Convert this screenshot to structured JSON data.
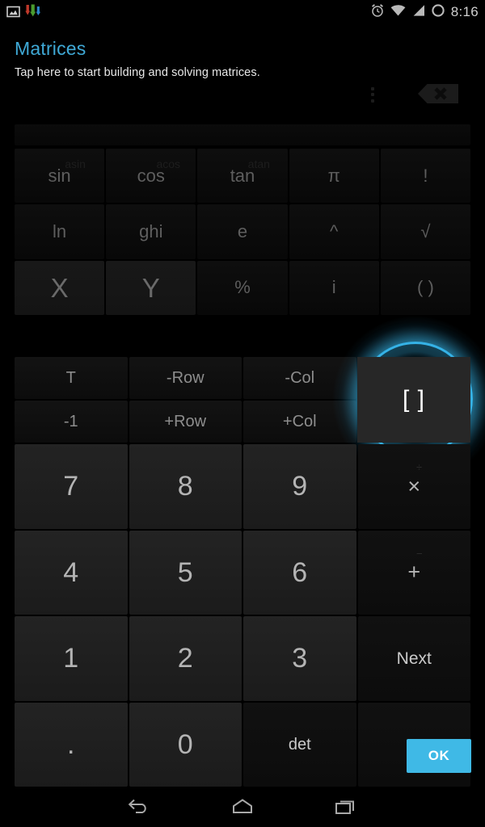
{
  "status_bar": {
    "left_icons": [
      {
        "name": "screenshot-icon",
        "label": "screenshot"
      },
      {
        "name": "downloads-icon",
        "label": "downloads"
      }
    ],
    "right_icons": [
      {
        "name": "alarm-icon",
        "label": "alarm"
      },
      {
        "name": "wifi-icon",
        "label": "wifi"
      },
      {
        "name": "signal-icon",
        "label": "cellular signal"
      },
      {
        "name": "battery-icon",
        "label": "battery"
      }
    ],
    "clock": "8:16"
  },
  "header": {
    "title": "Matrices",
    "title_color": "#3fa9d6",
    "subtitle": "Tap here to start building and solving matrices.",
    "overflow_label": "More options",
    "backspace_label": "Delete"
  },
  "display": {
    "value": ""
  },
  "function_keys": [
    {
      "main": "sin",
      "alt": "asin",
      "bright": false
    },
    {
      "main": "cos",
      "alt": "acos",
      "bright": false
    },
    {
      "main": "tan",
      "alt": "atan",
      "bright": false
    },
    {
      "main": "π",
      "alt": "",
      "bright": false
    },
    {
      "main": "!",
      "alt": "",
      "bright": false
    },
    {
      "main": "ln",
      "alt": "",
      "bright": false
    },
    {
      "main": "ghi",
      "alt": "",
      "bright": false
    },
    {
      "main": "e",
      "alt": "",
      "bright": false
    },
    {
      "main": "^",
      "alt": "",
      "bright": false
    },
    {
      "main": "√",
      "alt": "",
      "bright": false
    },
    {
      "main": "X",
      "alt": "",
      "bright": true
    },
    {
      "main": "Y",
      "alt": "",
      "bright": true
    },
    {
      "main": "%",
      "alt": "",
      "bright": false
    },
    {
      "main": "i",
      "alt": "",
      "bright": false
    },
    {
      "main": "( )",
      "alt": "",
      "bright": false
    }
  ],
  "matrix_op_keys": [
    {
      "main": "T"
    },
    {
      "main": "-Row"
    },
    {
      "main": "-Col"
    },
    {
      "main": "-1"
    },
    {
      "main": "+Row"
    },
    {
      "main": "+Col"
    }
  ],
  "focused_key": {
    "label": "[ ]",
    "name": "matrix-bracket-key",
    "ring_color": "#35b2e6"
  },
  "numeric_keys": [
    {
      "main": "7",
      "alt": "",
      "style": "digit"
    },
    {
      "main": "8",
      "alt": "",
      "style": "digit"
    },
    {
      "main": "9",
      "alt": "",
      "style": "digit"
    },
    {
      "main": "×",
      "alt": "÷",
      "style": "op"
    },
    {
      "main": "4",
      "alt": "",
      "style": "digit"
    },
    {
      "main": "5",
      "alt": "",
      "style": "digit"
    },
    {
      "main": "6",
      "alt": "",
      "style": "digit"
    },
    {
      "main": "+",
      "alt": "−",
      "style": "op"
    },
    {
      "main": "1",
      "alt": "",
      "style": "digit"
    },
    {
      "main": "2",
      "alt": "",
      "style": "digit"
    },
    {
      "main": "3",
      "alt": "",
      "style": "digit"
    },
    {
      "main": "Next",
      "alt": "",
      "style": "word"
    },
    {
      "main": ".",
      "alt": "",
      "style": "digit"
    },
    {
      "main": "0",
      "alt": "",
      "style": "digit"
    },
    {
      "main": "det",
      "alt": "",
      "style": "small"
    },
    {
      "main": "",
      "alt": "",
      "style": "blank"
    }
  ],
  "ok_button": {
    "label": "OK",
    "color": "#3fb9e6"
  },
  "nav_bar": {
    "back_label": "Back",
    "home_label": "Home",
    "recents_label": "Recent apps"
  }
}
